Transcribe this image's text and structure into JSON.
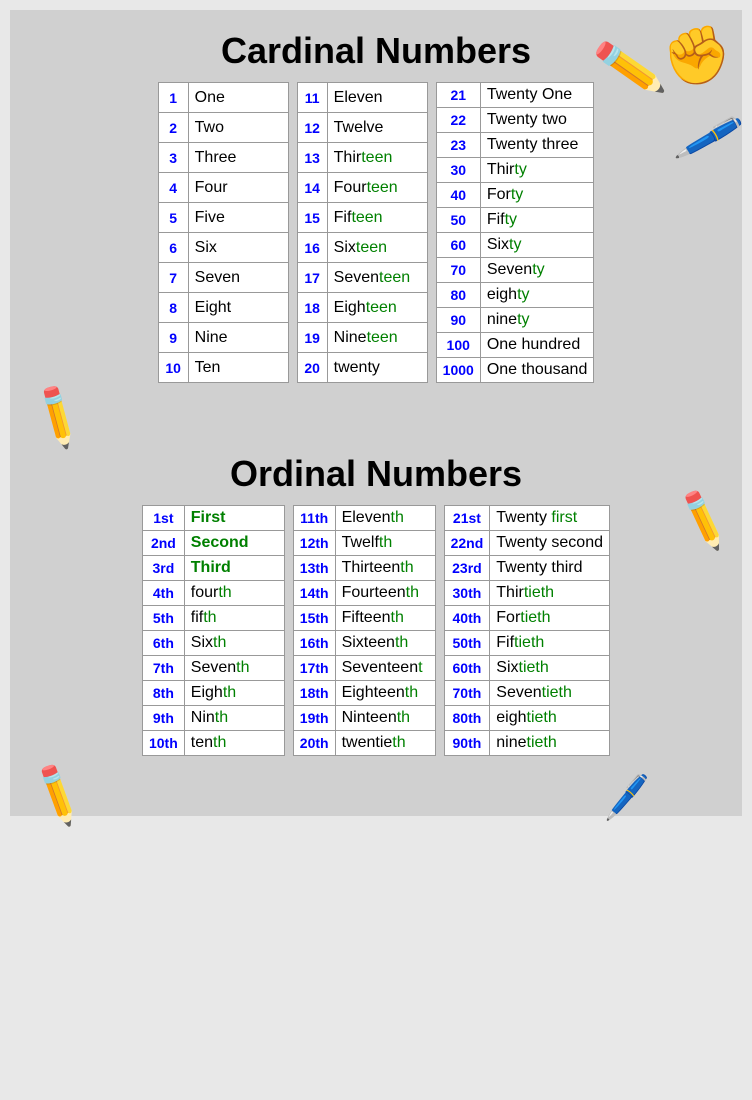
{
  "cardinal_title": "Cardinal Numbers",
  "ordinal_title": "Ordinal Numbers",
  "cardinal_col1": [
    {
      "num": "1",
      "word": "One"
    },
    {
      "num": "2",
      "word": "Two"
    },
    {
      "num": "3",
      "word": "Three"
    },
    {
      "num": "4",
      "word": "Four"
    },
    {
      "num": "5",
      "word": "Five"
    },
    {
      "num": "6",
      "word": "Six"
    },
    {
      "num": "7",
      "word": "Seven"
    },
    {
      "num": "8",
      "word": "Eight"
    },
    {
      "num": "9",
      "word": "Nine"
    },
    {
      "num": "10",
      "word": "Ten"
    }
  ],
  "cardinal_col2": [
    {
      "num": "11",
      "word_plain": "Eleven",
      "word_green": ""
    },
    {
      "num": "12",
      "word_plain": "Twelve",
      "word_green": ""
    },
    {
      "num": "13",
      "word_plain": "Thir",
      "word_green": "teen"
    },
    {
      "num": "14",
      "word_plain": "Four",
      "word_green": "teen"
    },
    {
      "num": "15",
      "word_plain": "Fif",
      "word_green": "teen"
    },
    {
      "num": "16",
      "word_plain": "Six",
      "word_green": "teen"
    },
    {
      "num": "17",
      "word_plain": "Seven",
      "word_green": "teen"
    },
    {
      "num": "18",
      "word_plain": "Eigh",
      "word_green": "teen"
    },
    {
      "num": "19",
      "word_plain": "Nine",
      "word_green": "teen"
    },
    {
      "num": "20",
      "word_plain": "twenty",
      "word_green": ""
    }
  ],
  "cardinal_col3": [
    {
      "num": "21",
      "word_plain": "Twenty One",
      "word_green": ""
    },
    {
      "num": "22",
      "word_plain": "Twenty two",
      "word_green": ""
    },
    {
      "num": "23",
      "word_plain": "Twenty three",
      "word_green": ""
    },
    {
      "num": "30",
      "word_plain": "Thir",
      "word_green": "ty"
    },
    {
      "num": "40",
      "word_plain": "For",
      "word_green": "ty"
    },
    {
      "num": "50",
      "word_plain": "Fif",
      "word_green": "ty"
    },
    {
      "num": "60",
      "word_plain": "Six",
      "word_green": "ty"
    },
    {
      "num": "70",
      "word_plain": "Seven",
      "word_green": "ty"
    },
    {
      "num": "80",
      "word_plain": "eigh",
      "word_green": "ty"
    },
    {
      "num": "90",
      "word_plain": "nine",
      "word_green": "ty"
    },
    {
      "num": "100",
      "word_plain": "One hundred",
      "word_green": ""
    },
    {
      "num": "1000",
      "word_plain": "One thousand",
      "word_green": ""
    }
  ],
  "ordinal_col1": [
    {
      "num": "1st",
      "word_green": "First",
      "suffix": ""
    },
    {
      "num": "2nd",
      "word_green": "Second",
      "suffix": ""
    },
    {
      "num": "3rd",
      "word_green": "Third",
      "suffix": ""
    },
    {
      "num": "4th",
      "word_plain": "four",
      "word_green": "th"
    },
    {
      "num": "5th",
      "word_plain": "fif",
      "word_green": "th"
    },
    {
      "num": "6th",
      "word_plain": "Six",
      "word_green": "th"
    },
    {
      "num": "7th",
      "word_plain": "Seven",
      "word_green": "th"
    },
    {
      "num": "8th",
      "word_plain": "Eigh",
      "word_green": "th"
    },
    {
      "num": "9th",
      "word_plain": "Nin",
      "word_green": "th"
    },
    {
      "num": "10th",
      "word_plain": "ten",
      "word_green": "th"
    }
  ],
  "ordinal_col2": [
    {
      "num": "11th",
      "word_plain": "Eleven",
      "word_green": "th"
    },
    {
      "num": "12th",
      "word_plain": "Twelf",
      "word_green": "th"
    },
    {
      "num": "13th",
      "word_plain": "Thirteen",
      "word_green": "th"
    },
    {
      "num": "14th",
      "word_plain": "Fourteen",
      "word_green": "th"
    },
    {
      "num": "15th",
      "word_plain": "Fifteen",
      "word_green": "th"
    },
    {
      "num": "16th",
      "word_plain": "Sixteen",
      "word_green": "th"
    },
    {
      "num": "17th",
      "word_plain": "Seventeen",
      "word_green": "t"
    },
    {
      "num": "18th",
      "word_plain": "Eighteen",
      "word_green": "th"
    },
    {
      "num": "19th",
      "word_plain": "Ninteen",
      "word_green": "th"
    },
    {
      "num": "20th",
      "word_plain": "twentie",
      "word_green": "th"
    }
  ],
  "ordinal_col3": [
    {
      "num": "21st",
      "word_plain": "Twenty ",
      "word_green": "first"
    },
    {
      "num": "22nd",
      "word_plain": "Twenty second",
      "word_green": ""
    },
    {
      "num": "23rd",
      "word_plain": "Twenty third",
      "word_green": ""
    },
    {
      "num": "30th",
      "word_plain": "Thir",
      "word_green": "tieth"
    },
    {
      "num": "40th",
      "word_plain": "For",
      "word_green": "tieth"
    },
    {
      "num": "50th",
      "word_plain": "Fif",
      "word_green": "tieth"
    },
    {
      "num": "60th",
      "word_plain": "Six",
      "word_green": "tieth"
    },
    {
      "num": "70th",
      "word_plain": "Seven",
      "word_green": "tieth"
    },
    {
      "num": "80th",
      "word_plain": "eigh",
      "word_green": "tieth"
    },
    {
      "num": "90th",
      "word_plain": "nine",
      "word_green": "tieth"
    }
  ]
}
